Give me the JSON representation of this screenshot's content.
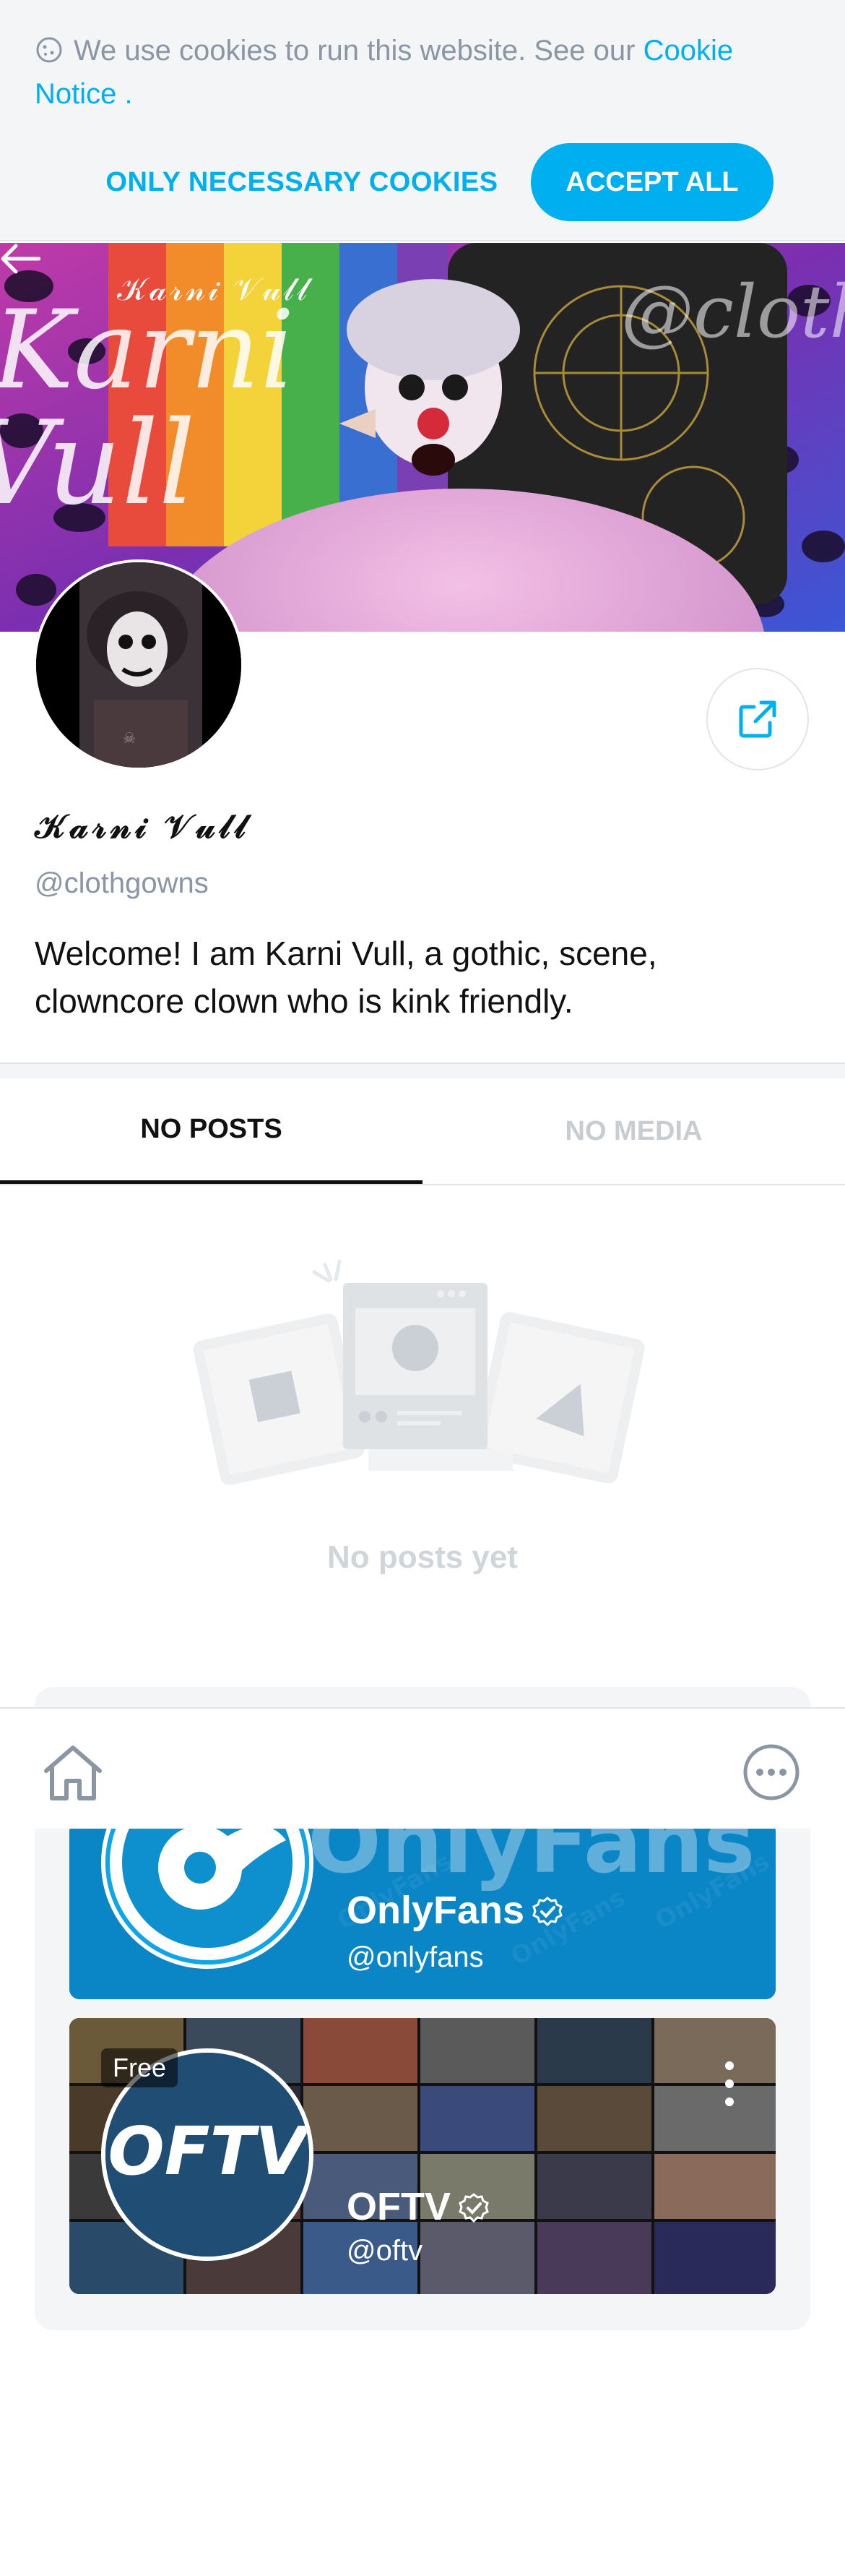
{
  "cookie_banner": {
    "text": "We use cookies to run this website. See our ",
    "link": "Cookie Notice",
    "suffix": " .",
    "necessary_button": "ONLY NECESSARY COOKIES",
    "accept_button": "ACCEPT ALL"
  },
  "profile": {
    "cover_title": "𝒦𝒶𝓇𝓃𝒾 𝒱𝓊𝓁𝓁",
    "name": "𝒦𝒶𝓇𝓃𝒾 𝒱𝓊𝓁𝓁",
    "handle": "@clothgowns",
    "bio": "Welcome! I am Karni Vull, a gothic, scene, clowncore clown who is kink friendly.",
    "cover_watermark_left": "Karni Vull",
    "cover_watermark_right": "@clothgo"
  },
  "tabs": [
    {
      "label": "NO POSTS",
      "active": true
    },
    {
      "label": "NO MEDIA",
      "active": false
    }
  ],
  "empty_state": {
    "text": "No posts yet"
  },
  "suggestions": [
    {
      "name": "OnlyFans",
      "handle": "@onlyfans",
      "banner_text": "OnlyFans",
      "verified": true
    },
    {
      "name": "OFTV",
      "handle": "@oftv",
      "badge": "Free",
      "logo_text": "OFTV",
      "verified": true
    }
  ],
  "icons": {
    "cookie": "cookie-icon",
    "back": "arrow-left-icon",
    "share": "share-icon",
    "home": "home-icon",
    "more": "more-horizontal-icon",
    "verified": "verified-check-icon"
  },
  "colors": {
    "accent": "#00aff0",
    "muted": "#8a96a3",
    "panel": "#f3f5f7"
  }
}
